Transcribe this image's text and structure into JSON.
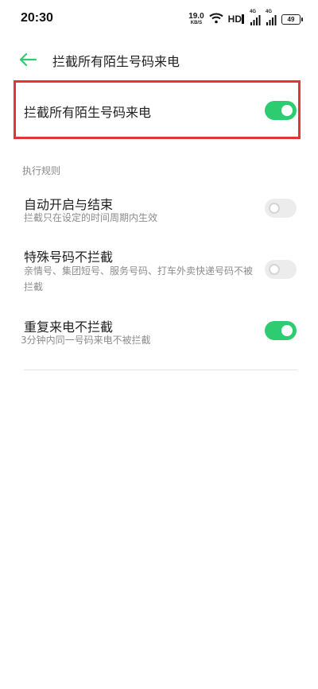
{
  "status_bar": {
    "time": "20:30",
    "net_speed_value": "19.0",
    "net_speed_unit": "KB/S",
    "hd_label": "HD",
    "signal1_tag": "4G",
    "signal2_tag": "4G",
    "battery": "49"
  },
  "toolbar": {
    "title": "拦截所有陌生号码来电"
  },
  "main_toggle": {
    "label": "拦截所有陌生号码来电",
    "on": true
  },
  "section": {
    "header": "执行规则",
    "items": [
      {
        "title": "自动开启与结束",
        "subtitle": "拦截只在设定的时间周期内生效",
        "on": false
      },
      {
        "title": "特殊号码不拦截",
        "subtitle": "亲情号、集团短号、服务号码、打车外卖快递号码不被拦截",
        "on": false
      },
      {
        "title": "重复来电不拦截",
        "subtitle": "3分钟内同一号码来电不被拦截",
        "on": true
      }
    ]
  },
  "colors": {
    "accent": "#2ecc71",
    "highlight": "#e0353c"
  }
}
